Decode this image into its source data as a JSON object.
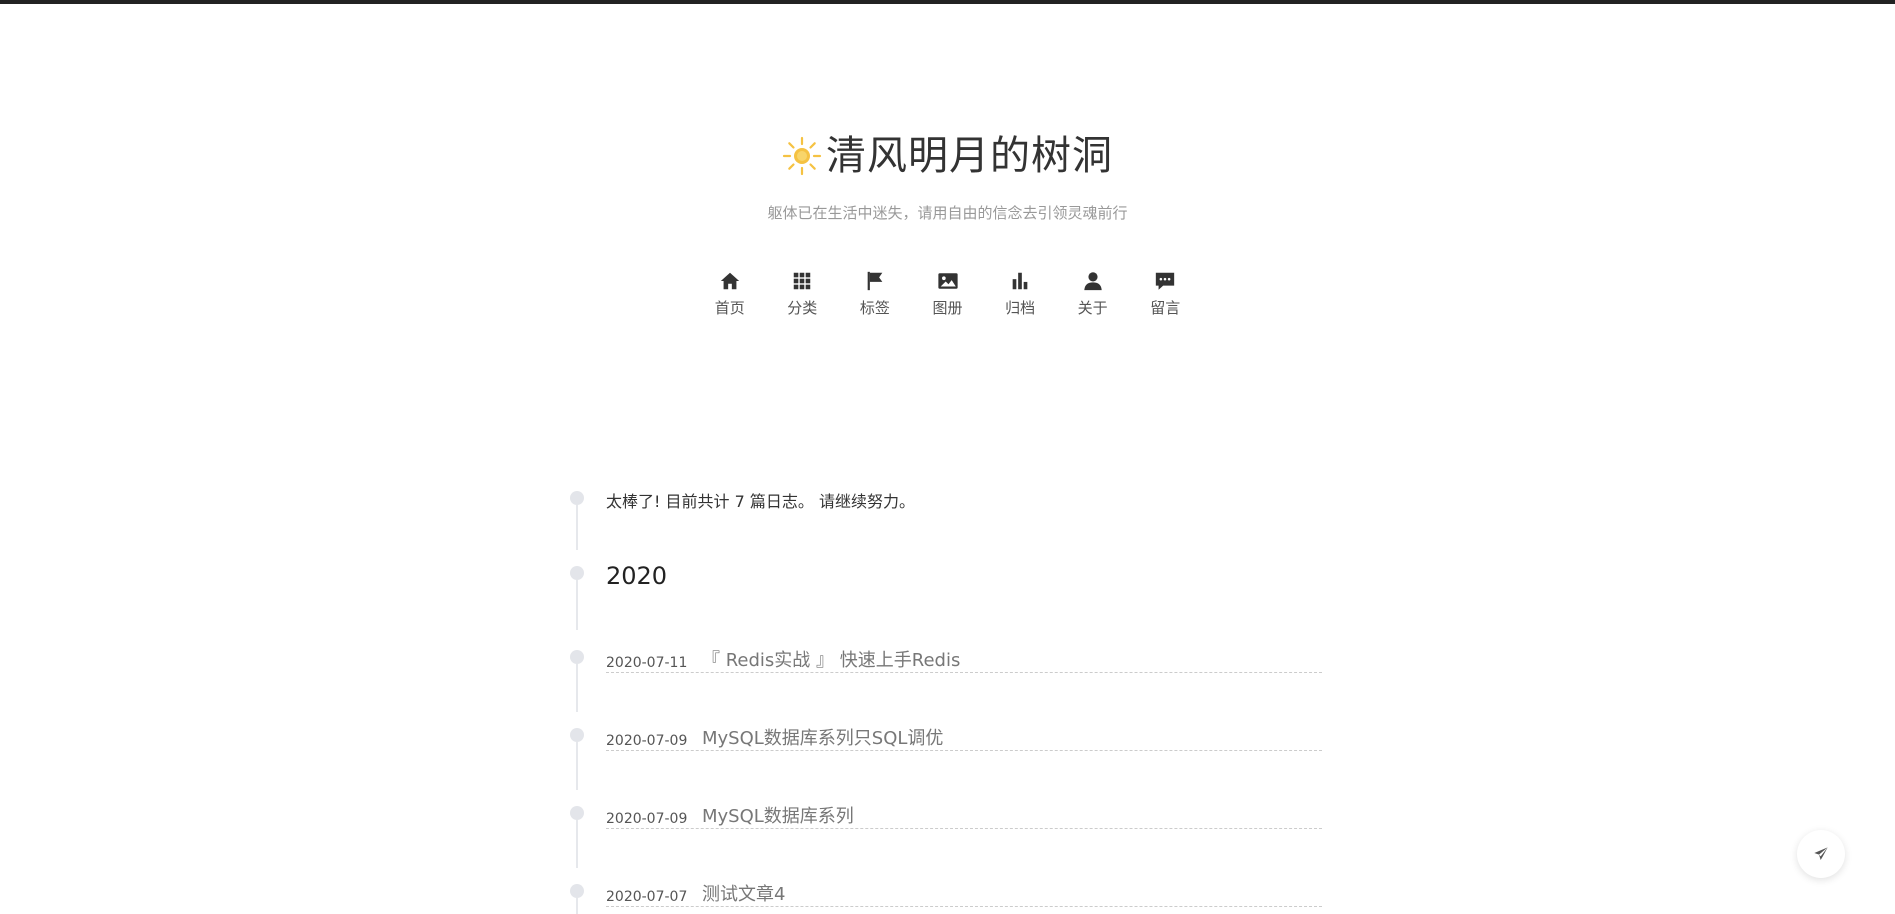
{
  "site": {
    "title": "清风明月的树洞",
    "subtitle": "躯体已在生活中迷失，请用自由的信念去引领灵魂前行",
    "logo_icon": "sun-icon",
    "accent_color": "#f5c242"
  },
  "menu": {
    "items": [
      {
        "label": "首页",
        "icon": "home-icon"
      },
      {
        "label": "分类",
        "icon": "grid-icon"
      },
      {
        "label": "标签",
        "icon": "flag-icon"
      },
      {
        "label": "图册",
        "icon": "image-icon"
      },
      {
        "label": "归档",
        "icon": "bar-chart-icon"
      },
      {
        "label": "关于",
        "icon": "user-icon"
      },
      {
        "label": "留言",
        "icon": "comment-icon"
      }
    ]
  },
  "archive": {
    "notice": "太棒了! 目前共计 7 篇日志。 请继续努力。",
    "year": "2020",
    "posts": [
      {
        "date": "2020-07-11",
        "title": "『 Redis实战 』 快速上手Redis"
      },
      {
        "date": "2020-07-09",
        "title": "MySQL数据库系列只SQL调优"
      },
      {
        "date": "2020-07-09",
        "title": "MySQL数据库系列"
      },
      {
        "date": "2020-07-07",
        "title": "测试文章4"
      }
    ]
  },
  "floating": {
    "icon": "paper-plane-icon"
  }
}
